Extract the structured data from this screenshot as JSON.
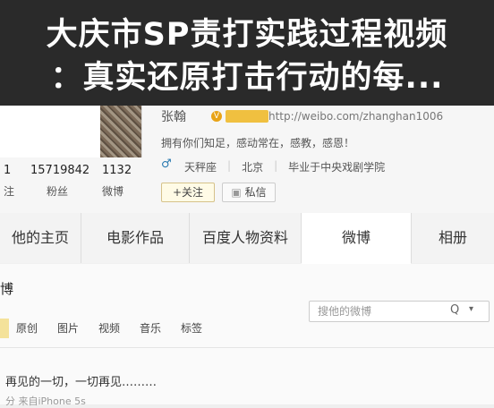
{
  "title": {
    "line1": "大庆市SP责打实践过程视频",
    "line2": "：真实还原打击行动的每..."
  },
  "profile": {
    "name": "张翰",
    "url": "http://weibo.com/zhanghan1006",
    "motto": "拥有你们知足，感动常在，感教，感恩！",
    "gender_symbol": "♂",
    "info": [
      "天秤座",
      "北京",
      "毕业于中央戏剧学院"
    ],
    "follow_label": "+关注",
    "message_label": "私信",
    "stats": [
      {
        "value": "1",
        "label": "注"
      },
      {
        "value": "15719842",
        "label": "粉丝"
      },
      {
        "value": "1132",
        "label": "微博"
      }
    ]
  },
  "tabs": [
    "他的主页",
    "电影作品",
    "百度人物资料",
    "微博",
    "相册"
  ],
  "active_tab": "微博",
  "feed": {
    "title": "博",
    "search_placeholder": "搜他的微博",
    "filters": [
      "原创",
      "图片",
      "视频",
      "音乐",
      "标签"
    ],
    "post_text": "再见的一切，一切再见………",
    "post_meta": "分 来自iPhone 5s"
  },
  "colors": {
    "banner": "#2a2a2a",
    "accent_yellow": "#f0c040",
    "link_blue": "#2a7ab0"
  }
}
